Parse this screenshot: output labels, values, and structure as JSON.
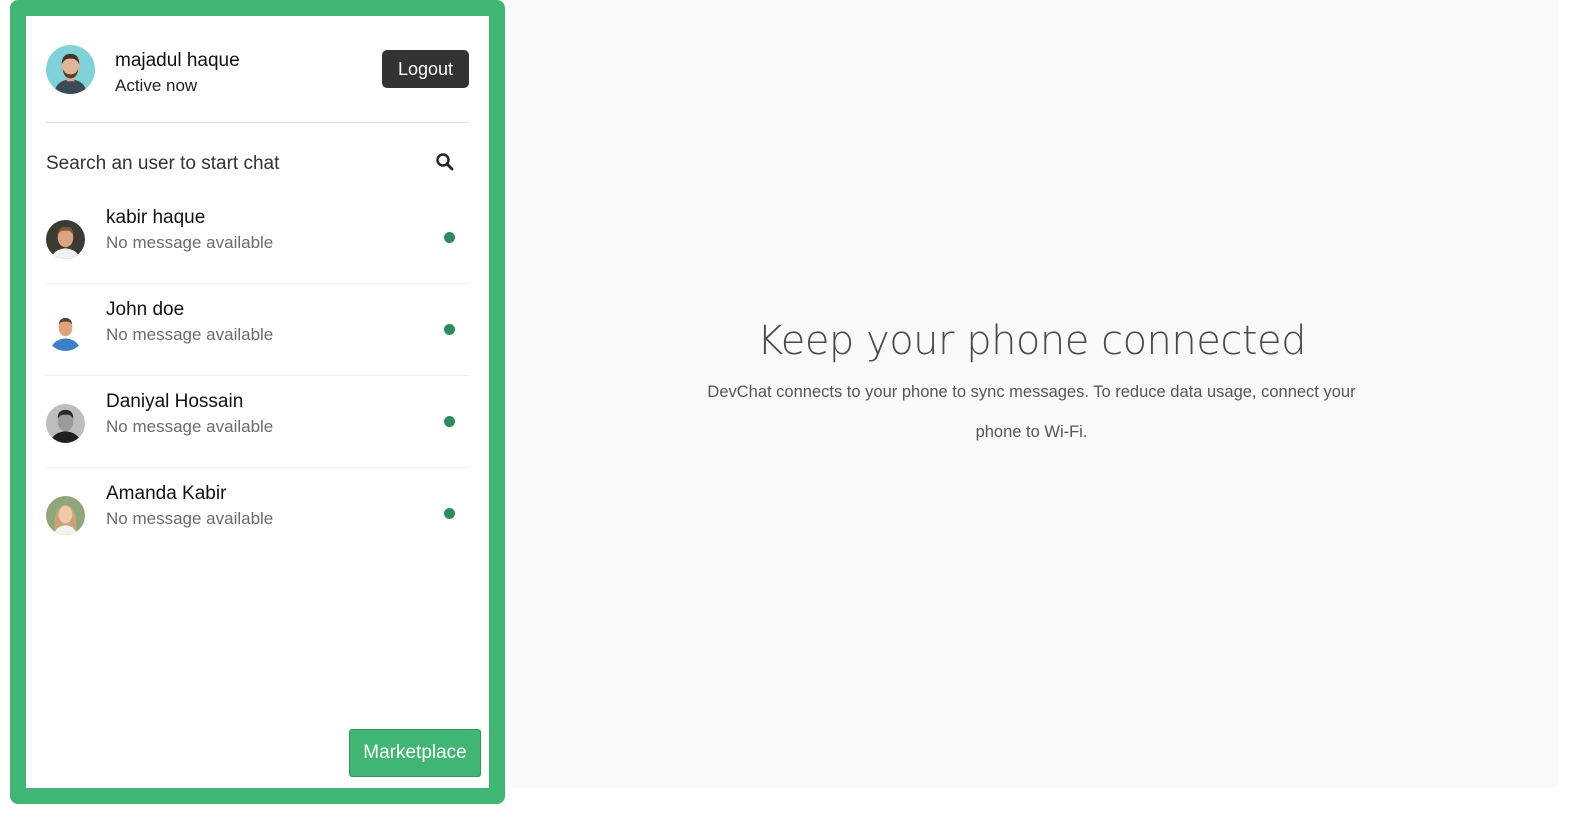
{
  "profile": {
    "name": "majadul haque",
    "status": "Active now",
    "logout_label": "Logout"
  },
  "search": {
    "placeholder": "Search an user to start chat",
    "icon": "search-icon"
  },
  "users": [
    {
      "name": "kabir haque",
      "last_message": "No message available",
      "online": true
    },
    {
      "name": "John doe",
      "last_message": "No message available",
      "online": true
    },
    {
      "name": "Daniyal Hossain",
      "last_message": "No message available",
      "online": true
    },
    {
      "name": "Amanda Kabir",
      "last_message": "No message available",
      "online": true
    }
  ],
  "marketplace_label": "Marketplace",
  "main": {
    "title": "Keep your phone connected",
    "description": "DevChat connects to your phone to sync messages. To reduce data usage, connect your phone to Wi-Fi."
  },
  "colors": {
    "accent": "#41b574",
    "online": "#2f8a5e",
    "logout_bg": "#333333",
    "main_bg": "#f8f9fa"
  }
}
